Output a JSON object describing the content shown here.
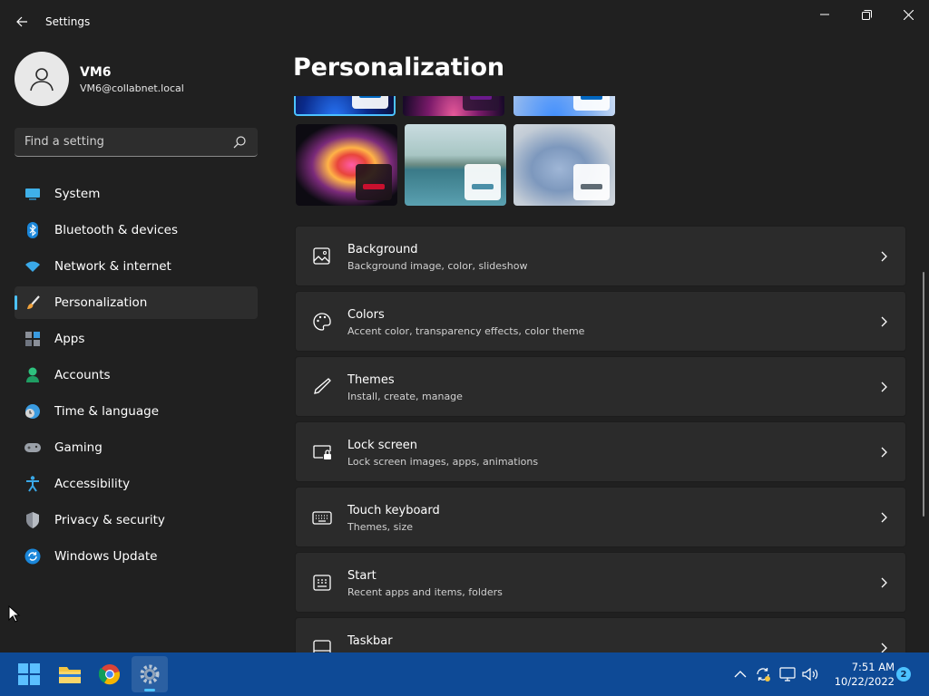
{
  "window": {
    "title": "Settings"
  },
  "user": {
    "name": "VM6",
    "email": "VM6@collabnet.local"
  },
  "search": {
    "placeholder": "Find a setting"
  },
  "nav": [
    {
      "label": "System",
      "icon": "system-icon"
    },
    {
      "label": "Bluetooth & devices",
      "icon": "bluetooth-icon"
    },
    {
      "label": "Network & internet",
      "icon": "wifi-icon"
    },
    {
      "label": "Personalization",
      "icon": "brush-icon",
      "active": true
    },
    {
      "label": "Apps",
      "icon": "apps-icon"
    },
    {
      "label": "Accounts",
      "icon": "person-icon"
    },
    {
      "label": "Time & language",
      "icon": "clock-globe-icon"
    },
    {
      "label": "Gaming",
      "icon": "gamepad-icon"
    },
    {
      "label": "Accessibility",
      "icon": "accessibility-icon"
    },
    {
      "label": "Privacy & security",
      "icon": "shield-icon"
    },
    {
      "label": "Windows Update",
      "icon": "update-icon"
    }
  ],
  "page": {
    "title": "Personalization"
  },
  "themes": [
    {
      "accent": "#0067c0",
      "selected": true
    },
    {
      "accent": "#6b1a8c"
    },
    {
      "accent": "#0067c0"
    },
    {
      "accent": "#c8102e"
    },
    {
      "accent": "#4a8fa8"
    },
    {
      "accent": "#5f6b74"
    }
  ],
  "cards": [
    {
      "title": "Background",
      "subtitle": "Background image, color, slideshow",
      "icon": "image-icon"
    },
    {
      "title": "Colors",
      "subtitle": "Accent color, transparency effects, color theme",
      "icon": "palette-icon"
    },
    {
      "title": "Themes",
      "subtitle": "Install, create, manage",
      "icon": "pen-icon"
    },
    {
      "title": "Lock screen",
      "subtitle": "Lock screen images, apps, animations",
      "icon": "lock-screen-icon"
    },
    {
      "title": "Touch keyboard",
      "subtitle": "Themes, size",
      "icon": "keyboard-icon"
    },
    {
      "title": "Start",
      "subtitle": "Recent apps and items, folders",
      "icon": "start-icon"
    },
    {
      "title": "Taskbar",
      "subtitle": "",
      "icon": "taskbar-icon"
    }
  ],
  "taskbar": {
    "time": "7:51 AM",
    "date": "10/22/2022",
    "notifications": "2"
  },
  "colors": {
    "accent": "#4cc2ff",
    "background": "#202020",
    "card": "#2b2b2b",
    "taskbar": "#0e4a96"
  }
}
